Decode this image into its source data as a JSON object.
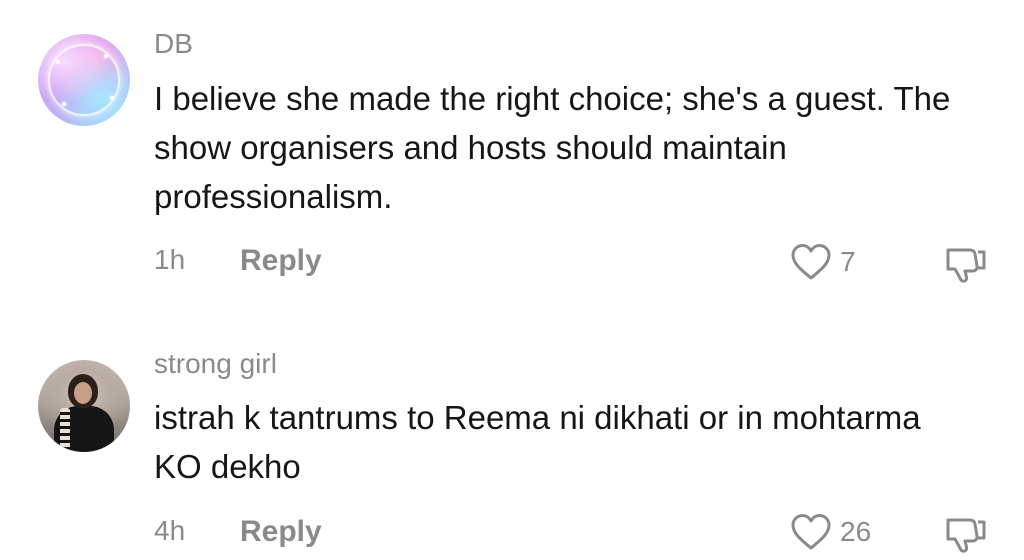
{
  "comments": [
    {
      "username": "DB",
      "text": "I believe she made the right choice; she's a guest. The show organisers and hosts should maintain professionalism.",
      "time": "1h",
      "reply_label": "Reply",
      "likes": "7",
      "avatar_icon": "neon-circle-avatar"
    },
    {
      "username": "strong girl",
      "text": "istrah k tantrums to Reema ni dikhati or in mohtarma KO dekho",
      "time": "4h",
      "reply_label": "Reply",
      "likes": "26",
      "avatar_icon": "woman-selfie-avatar"
    }
  ],
  "icons": {
    "like": "heart-outline-icon",
    "dislike": "thumbs-down-outline-icon"
  },
  "colors": {
    "text": "#161616",
    "muted": "#8a8a8a",
    "icon": "#8a8a8a",
    "background": "#ffffff"
  }
}
